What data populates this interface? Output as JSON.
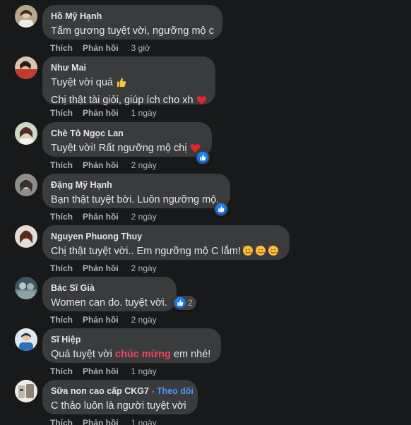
{
  "actions": {
    "like": "Thích",
    "reply": "Phản hồi"
  },
  "colors": {
    "background": "#18191a",
    "bubble": "#3a3b3c",
    "text": "#e4e6eb",
    "secondary": "#b0b3b8",
    "link_blue": "#4599ff",
    "highlight_red": "#f3425f"
  },
  "comments": [
    {
      "author": "Hồ Mỹ Hạnh",
      "lines": [
        "Tấm gương tuyệt vời, ngưỡng mộ c"
      ],
      "time": "3 giờ"
    },
    {
      "author": "Như Mai",
      "lines": [
        "Tuyệt vời quá",
        "Chị thật tài giỏi, giúp ích cho xh"
      ],
      "emojis": [
        "thumbs-up-emoji",
        "red-heart-emoji"
      ],
      "time": "1 ngày"
    },
    {
      "author": "Chè Tô Ngọc Lan",
      "lines": [
        "Tuyệt vời! Rất ngưỡng mộ chị"
      ],
      "emojis": [
        "red-heart-emoji"
      ],
      "reaction": "like-reaction-icon",
      "time": "2 ngày"
    },
    {
      "author": "Đặng Mỹ Hạnh",
      "lines": [
        "Bạn thật tuyệt bời. Luôn ngưỡng mộ."
      ],
      "reaction": "like-reaction-icon",
      "time": "2 ngày"
    },
    {
      "author": "Nguyen Phuong Thuy",
      "lines": [
        "Chị thật tuyệt vời.. Em ngưỡng mộ C lắm!"
      ],
      "emojis": [
        "smiling-face-with-hearts-emoji",
        "smiling-face-with-hearts-emoji",
        "smiling-face-with-hearts-emoji"
      ],
      "time": "2 ngày"
    },
    {
      "author": "Bác Sĩ Già",
      "lines": [
        "Women can do. tuyệt vời."
      ],
      "reaction": "like-reaction-icon",
      "reaction_count": "2",
      "time": "2 ngày"
    },
    {
      "author": "Sĩ Hiệp",
      "text_before": "Quá tuyệt vời",
      "text_highlight": "chúc mừng",
      "text_after": "em nhé!",
      "time": "1 ngày"
    },
    {
      "author": "Sữa non cao cấp CKG7",
      "separator": "·",
      "follow": "Theo dõi",
      "lines": [
        "C thảo luôn là người tuyệt vời"
      ],
      "time": "1 ngày"
    }
  ]
}
